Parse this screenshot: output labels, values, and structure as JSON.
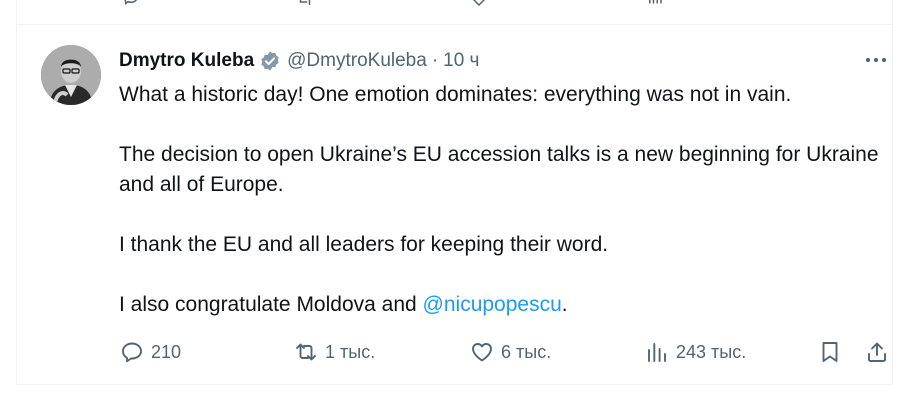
{
  "author": {
    "name": "Dmytro Kuleba",
    "handle": "@DmytroKuleba",
    "separator": "·",
    "time": "10 ч",
    "verified_color": "#829aab"
  },
  "tweet": {
    "paragraphs": [
      "What a historic day! One emotion dominates: everything was not in vain.",
      "The decision to open Ukraine’s EU accession talks is a new beginning for Ukraine and all of Europe.",
      "I thank the EU and all leaders for keeping their word."
    ],
    "last_paragraph_prefix": "I also congratulate Moldova and ",
    "mention": "@nicupopescu",
    "last_paragraph_suffix": "."
  },
  "actions": {
    "replies": "210",
    "reposts": "1 тыс.",
    "likes": "6 тыс.",
    "views": "243 тыс."
  },
  "icons": {
    "reply": "reply-icon",
    "repost": "repost-icon",
    "like": "heart-icon",
    "views": "views-chart-icon",
    "bookmark": "bookmark-icon",
    "share": "share-icon",
    "more": "more-dots-icon"
  },
  "colors": {
    "text": "#0f1419",
    "muted": "#536471",
    "link": "#1d9bf0",
    "border": "#eff3f4"
  }
}
